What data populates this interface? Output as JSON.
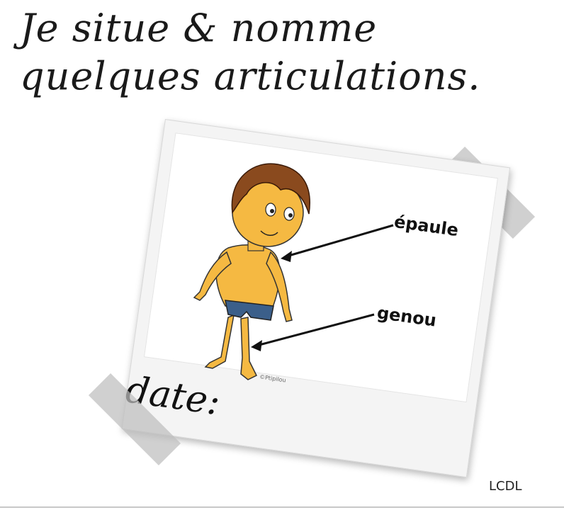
{
  "title": "Je situe & nomme quelques articulations.",
  "labels": {
    "shoulder": "épaule",
    "knee": "genou"
  },
  "date_label": "date:",
  "watermark": "©Ptipilou",
  "credit": "LCDL",
  "colors": {
    "skin": "#f5b942",
    "hair": "#8a4a1e",
    "shorts": "#3b5f8a",
    "tape": "#bebebe"
  }
}
